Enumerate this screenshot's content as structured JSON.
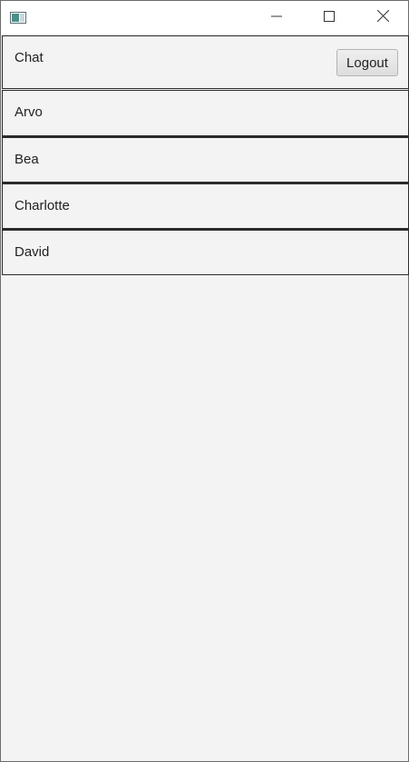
{
  "window": {
    "controls": {
      "minimize_icon": "minimize-icon",
      "maximize_icon": "maximize-icon",
      "close_icon": "close-icon"
    }
  },
  "header": {
    "title": "Chat",
    "logout_label": "Logout"
  },
  "contacts": [
    {
      "name": "Arvo"
    },
    {
      "name": "Bea"
    },
    {
      "name": "Charlotte"
    },
    {
      "name": "David"
    }
  ],
  "colors": {
    "background": "#f3f3f3",
    "border": "#2b2b2b",
    "text": "#222222"
  }
}
